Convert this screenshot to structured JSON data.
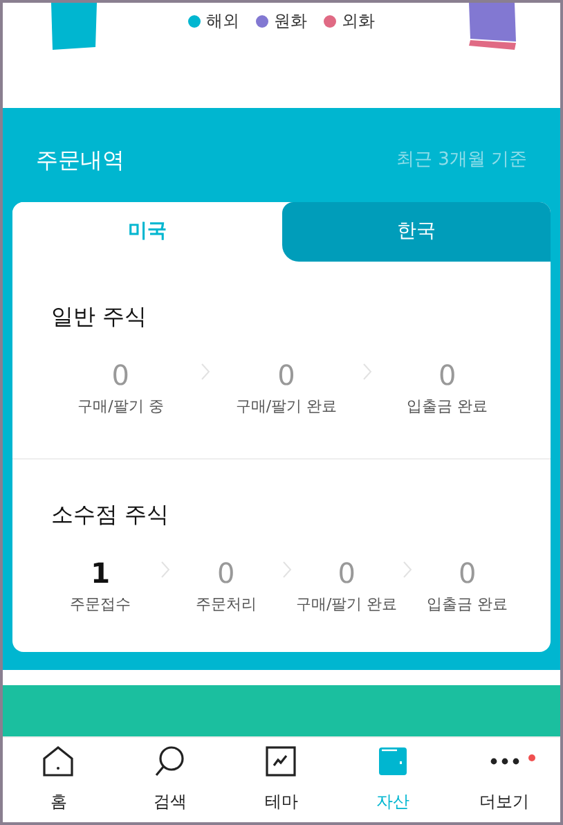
{
  "legend": [
    {
      "label": "해외",
      "color": "#00b6d0"
    },
    {
      "label": "원화",
      "color": "#8278d2"
    },
    {
      "label": "외화",
      "color": "#e06a84"
    }
  ],
  "orders": {
    "title": "주문내역",
    "note": "최근 3개월 기준",
    "tabs": [
      {
        "label": "미국",
        "selected": true
      },
      {
        "label": "한국",
        "selected": false
      }
    ],
    "sections": [
      {
        "title": "일반 주식",
        "steps": [
          {
            "count": "0",
            "label": "구매/팔기 중",
            "active": false
          },
          {
            "count": "0",
            "label": "구매/팔기 완료",
            "active": false
          },
          {
            "count": "0",
            "label": "입출금 완료",
            "active": false
          }
        ]
      },
      {
        "title": "소수점 주식",
        "steps": [
          {
            "count": "1",
            "label": "주문접수",
            "active": true
          },
          {
            "count": "0",
            "label": "주문처리",
            "active": false
          },
          {
            "count": "0",
            "label": "구매/팔기 완료",
            "active": false
          },
          {
            "count": "0",
            "label": "입출금 완료",
            "active": false
          }
        ]
      }
    ]
  },
  "nav": [
    {
      "kind": "home",
      "label": "홈",
      "selected": false
    },
    {
      "kind": "search",
      "label": "검색",
      "selected": false
    },
    {
      "kind": "theme",
      "label": "테마",
      "selected": false
    },
    {
      "kind": "assets",
      "label": "자산",
      "selected": true
    },
    {
      "kind": "more",
      "label": "더보기",
      "selected": false,
      "badge": true
    }
  ]
}
